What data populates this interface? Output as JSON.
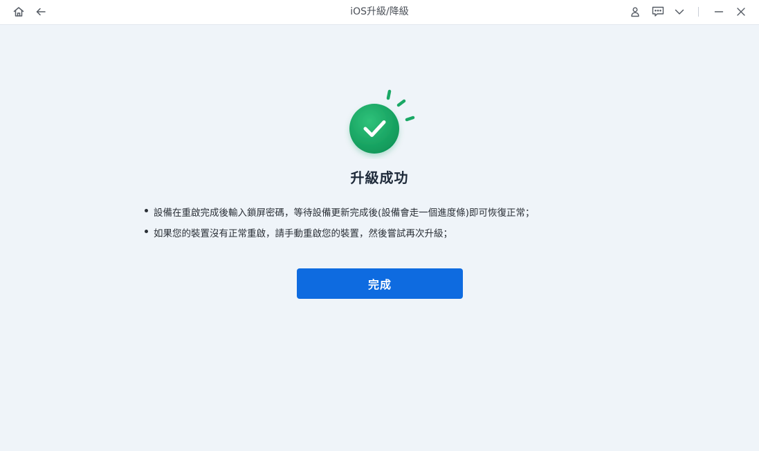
{
  "window": {
    "title": "iOS升級/降級"
  },
  "titlebar": {
    "icons": {
      "home": "home-icon",
      "back": "back-arrow-icon",
      "account": "user-icon",
      "feedback": "chat-icon",
      "menu": "chevron-down-icon",
      "minimize": "minimize-icon",
      "close": "close-icon"
    }
  },
  "result": {
    "icon": "success-check-icon",
    "heading": "升級成功",
    "tips": [
      "設備在重啟完成後輸入鎖屏密碼，等待設備更新完成後(設備會走一個進度條)即可恢復正常；",
      "如果您的裝置沒有正常重啟，請手動重啟您的裝置，然後嘗試再次升級；"
    ],
    "done_label": "完成"
  },
  "colors": {
    "background": "#eff4f9",
    "titlebar": "#ffffff",
    "accent_button": "#0e6be0",
    "success_green": "#1aa865"
  }
}
